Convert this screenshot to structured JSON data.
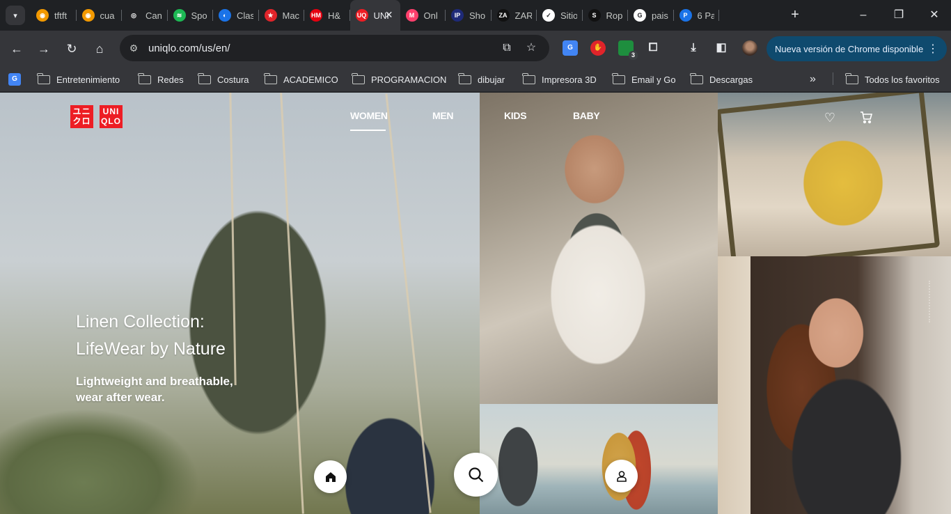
{
  "browser": {
    "tabs": [
      {
        "title": "tftft",
        "color": "#f29900",
        "glyph": "◉"
      },
      {
        "title": "cua",
        "color": "#f29900",
        "glyph": "◉"
      },
      {
        "title": "Can",
        "color": "#202124",
        "glyph": "◎"
      },
      {
        "title": "Spo",
        "color": "#1db954",
        "glyph": "≋"
      },
      {
        "title": "Clas",
        "color": "#1a73e8",
        "glyph": "◐"
      },
      {
        "title": "Mac",
        "color": "#e0242a",
        "glyph": "★"
      },
      {
        "title": "H&",
        "color": "#e50010",
        "glyph": "HM"
      },
      {
        "title": "UNI",
        "color": "#ed1d24",
        "glyph": "UQ",
        "active": true
      },
      {
        "title": "Onl",
        "color": "#ff3f6c",
        "glyph": "M"
      },
      {
        "title": "Sho",
        "color": "#1e2a78",
        "glyph": "IP"
      },
      {
        "title": "ZAR",
        "color": "#111111",
        "glyph": "ZA"
      },
      {
        "title": "Sitio",
        "color": "#ffffff",
        "glyph": "✓"
      },
      {
        "title": "Rop",
        "color": "#111111",
        "glyph": "S"
      },
      {
        "title": "pais",
        "color": "#ffffff",
        "glyph": "G"
      },
      {
        "title": "6 Pa",
        "color": "#1a73e8",
        "glyph": "P"
      }
    ],
    "active_tab_close": "✕",
    "new_tab": "+",
    "url": "uniqlo.com/us/en/",
    "update_button": "Nueva versión de Chrome disponible",
    "extension_badge": "3",
    "bookmarks": [
      "Entretenimiento",
      "Redes",
      "Costura",
      "ACADEMICO",
      "PROGRAMACION",
      "dibujar",
      "Impresora 3D",
      "Email y Go",
      "Descargas"
    ],
    "bookmarks_more": "»",
    "all_bookmarks": "Todos los favoritos"
  },
  "site": {
    "logo_top": "UNI",
    "logo_bottom": "QLO",
    "logo_left_top": "ユニ",
    "logo_left_bottom": "クロ",
    "nav": [
      "WOMEN",
      "MEN",
      "KIDS",
      "BABY"
    ],
    "active_nav": "WOMEN",
    "hero_title_line1": "Linen Collection:",
    "hero_title_line2": "LifeWear by Nature",
    "hero_sub_line1": "Lightweight and breathable,",
    "hero_sub_line2": "wear after wear."
  },
  "colors": {
    "brand_red": "#ed1d24",
    "chrome_dark": "#202124",
    "chrome_toolbar": "#35363a",
    "update_pill": "#0f4a6e"
  },
  "icons": {
    "home": "home-icon",
    "search": "search-icon",
    "account": "user-icon",
    "wishlist": "heart-icon",
    "cart": "cart-icon"
  }
}
